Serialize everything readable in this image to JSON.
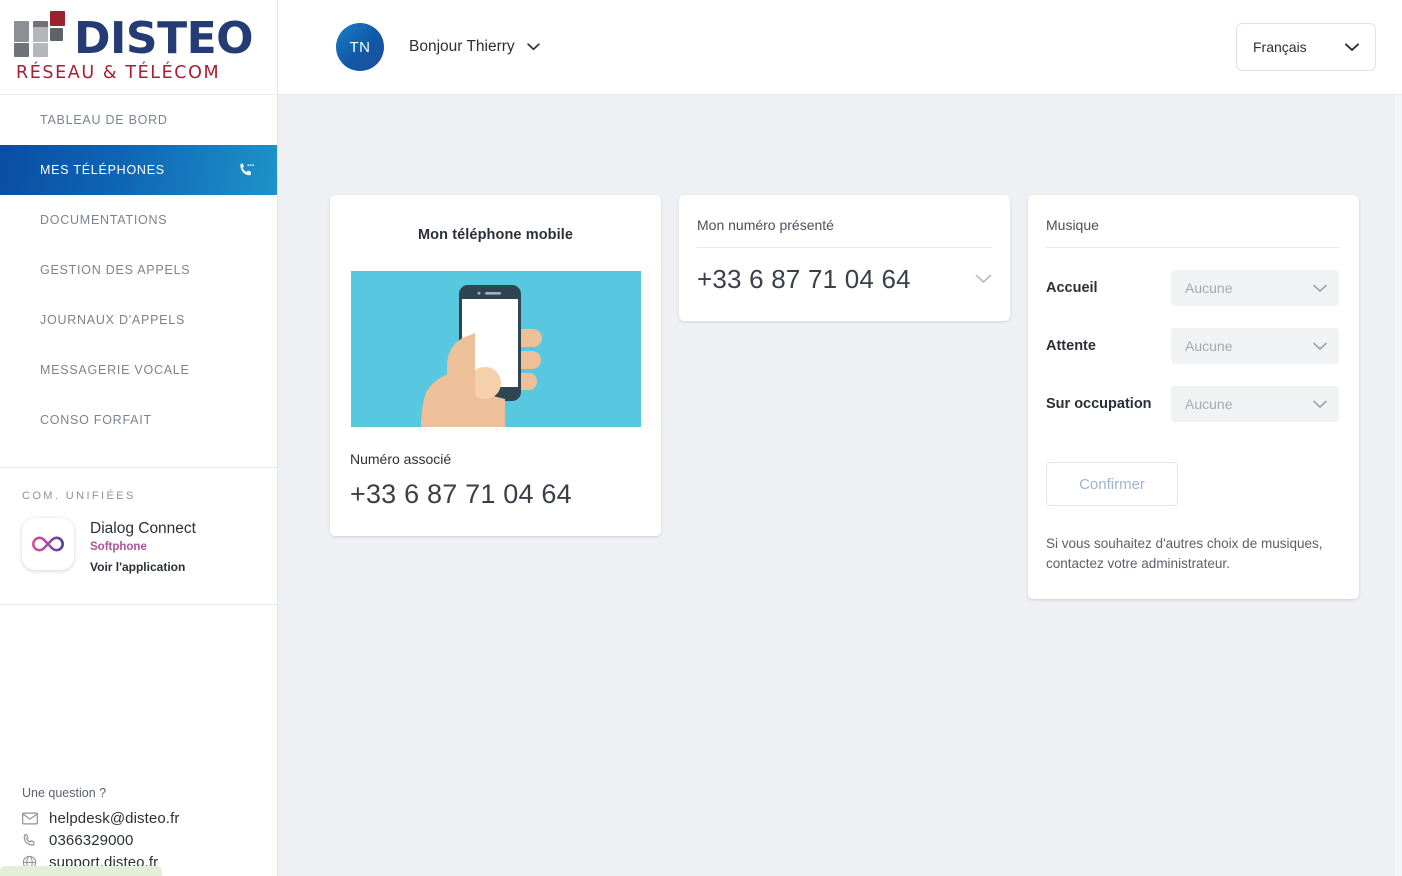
{
  "brand": {
    "name": "DISTEO",
    "tagline": "RÉSEAU & TÉLÉCOM",
    "logo_navy": "#243c73",
    "logo_red": "#a52030"
  },
  "sidebar": {
    "nav_items": [
      {
        "label": "TABLEAU DE BORD",
        "active": false,
        "icon": ""
      },
      {
        "label": "MES TÉLÉPHONES",
        "active": true,
        "icon": "phone-call-icon"
      },
      {
        "label": "DOCUMENTATIONS",
        "active": false,
        "icon": ""
      },
      {
        "label": "GESTION DES APPELS",
        "active": false,
        "icon": ""
      },
      {
        "label": "JOURNAUX D'APPELS",
        "active": false,
        "icon": ""
      },
      {
        "label": "MESSAGERIE VOCALE",
        "active": false,
        "icon": ""
      },
      {
        "label": "CONSO FORFAIT",
        "active": false,
        "icon": ""
      }
    ],
    "section_title": "COM. UNIFIÉES",
    "app": {
      "icon": "infinity-icon",
      "name": "Dialog Connect",
      "kind": "Softphone",
      "link": "Voir l'application",
      "kind_color": "#b0519b"
    },
    "footer": {
      "question": "Une question ?",
      "contacts": [
        {
          "icon": "mail-icon",
          "text": "helpdesk@disteo.fr"
        },
        {
          "icon": "phone-icon",
          "text": "0366329000"
        },
        {
          "icon": "globe-icon",
          "text": "support.disteo.fr"
        }
      ]
    }
  },
  "topbar": {
    "avatar_initials": "TN",
    "greeting": "Bonjour Thierry",
    "caret_icon": "chevron-down-icon",
    "language": {
      "value": "Français",
      "caret_icon": "chevron-down-icon"
    }
  },
  "cards": {
    "mobile": {
      "title": "Mon téléphone mobile",
      "illustration": "hand-holding-smartphone-illustration",
      "illustration_bg": "#57c8e0",
      "associated_label": "Numéro associé",
      "associated_number": "+33 6 87 71 04 64"
    },
    "presented_number": {
      "title": "Mon numéro présenté",
      "value": "+33 6 87 71 04 64",
      "caret_icon": "chevron-down-icon"
    },
    "music": {
      "title": "Musique",
      "rows": [
        {
          "label": "Accueil",
          "value": "Aucune",
          "caret_icon": "chevron-down-icon"
        },
        {
          "label": "Attente",
          "value": "Aucune",
          "caret_icon": "chevron-down-icon"
        },
        {
          "label": "Sur occupation",
          "value": "Aucune",
          "caret_icon": "chevron-down-icon"
        }
      ],
      "confirm_label": "Confirmer",
      "hint": "Si vous souhaitez d'autres choix de musiques, contactez votre administrateur."
    }
  }
}
